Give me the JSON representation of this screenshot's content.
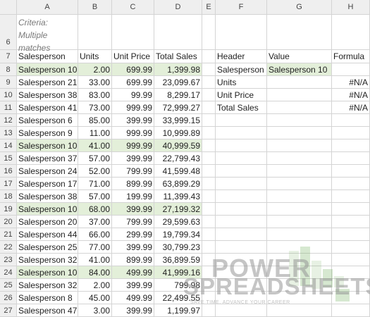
{
  "columns": [
    "A",
    "B",
    "C",
    "D",
    "E",
    "F",
    "G",
    "H"
  ],
  "notes": [
    "Criteria:",
    "Multiple",
    "matches"
  ],
  "header_row": {
    "num": "7",
    "a": "Salesperson",
    "b": "Units",
    "c": "Unit Price",
    "d": "Total Sales",
    "f": "Header",
    "g": "Value",
    "h": "Formula"
  },
  "rows": [
    {
      "num": "8",
      "a": "Salesperson 10",
      "b": "2.00",
      "c": "699.99",
      "d": "1,399.98",
      "f": "Salesperson",
      "g": "Salesperson 10",
      "h": "",
      "hl": true
    },
    {
      "num": "9",
      "a": "Salesperson 21",
      "b": "33.00",
      "c": "699.99",
      "d": "23,099.67",
      "f": "Units",
      "g": "",
      "h": "#N/A",
      "hl": false
    },
    {
      "num": "10",
      "a": "Salesperson 38",
      "b": "83.00",
      "c": "99.99",
      "d": "8,299.17",
      "f": "Unit Price",
      "g": "",
      "h": "#N/A",
      "hl": false
    },
    {
      "num": "11",
      "a": "Salesperson 41",
      "b": "73.00",
      "c": "999.99",
      "d": "72,999.27",
      "f": "Total Sales",
      "g": "",
      "h": "#N/A",
      "hl": false
    },
    {
      "num": "12",
      "a": "Salesperson 6",
      "b": "85.00",
      "c": "399.99",
      "d": "33,999.15",
      "f": "",
      "g": "",
      "h": "",
      "hl": false
    },
    {
      "num": "13",
      "a": "Salesperson 9",
      "b": "11.00",
      "c": "999.99",
      "d": "10,999.89",
      "f": "",
      "g": "",
      "h": "",
      "hl": false
    },
    {
      "num": "14",
      "a": "Salesperson 10",
      "b": "41.00",
      "c": "999.99",
      "d": "40,999.59",
      "f": "",
      "g": "",
      "h": "",
      "hl": true
    },
    {
      "num": "15",
      "a": "Salesperson 37",
      "b": "57.00",
      "c": "399.99",
      "d": "22,799.43",
      "f": "",
      "g": "",
      "h": "",
      "hl": false
    },
    {
      "num": "16",
      "a": "Salesperson 24",
      "b": "52.00",
      "c": "799.99",
      "d": "41,599.48",
      "f": "",
      "g": "",
      "h": "",
      "hl": false
    },
    {
      "num": "17",
      "a": "Salesperson 17",
      "b": "71.00",
      "c": "899.99",
      "d": "63,899.29",
      "f": "",
      "g": "",
      "h": "",
      "hl": false
    },
    {
      "num": "18",
      "a": "Salesperson 38",
      "b": "57.00",
      "c": "199.99",
      "d": "11,399.43",
      "f": "",
      "g": "",
      "h": "",
      "hl": false
    },
    {
      "num": "19",
      "a": "Salesperson 10",
      "b": "68.00",
      "c": "399.99",
      "d": "27,199.32",
      "f": "",
      "g": "",
      "h": "",
      "hl": true
    },
    {
      "num": "20",
      "a": "Salesperson 20",
      "b": "37.00",
      "c": "799.99",
      "d": "29,599.63",
      "f": "",
      "g": "",
      "h": "",
      "hl": false
    },
    {
      "num": "21",
      "a": "Salesperson 44",
      "b": "66.00",
      "c": "299.99",
      "d": "19,799.34",
      "f": "",
      "g": "",
      "h": "",
      "hl": false
    },
    {
      "num": "22",
      "a": "Salesperson 25",
      "b": "77.00",
      "c": "399.99",
      "d": "30,799.23",
      "f": "",
      "g": "",
      "h": "",
      "hl": false
    },
    {
      "num": "23",
      "a": "Salesperson 32",
      "b": "41.00",
      "c": "899.99",
      "d": "36,899.59",
      "f": "",
      "g": "",
      "h": "",
      "hl": false
    },
    {
      "num": "24",
      "a": "Salesperson 10",
      "b": "84.00",
      "c": "499.99",
      "d": "41,999.16",
      "f": "",
      "g": "",
      "h": "",
      "hl": true
    },
    {
      "num": "25",
      "a": "Salesperson 32",
      "b": "2.00",
      "c": "399.99",
      "d": "799.98",
      "f": "",
      "g": "",
      "h": "",
      "hl": false
    },
    {
      "num": "26",
      "a": "Salesperson 8",
      "b": "45.00",
      "c": "499.99",
      "d": "22,499.55",
      "f": "",
      "g": "",
      "h": "",
      "hl": false
    },
    {
      "num": "27",
      "a": "Salesperson 47",
      "b": "3.00",
      "c": "399.99",
      "d": "1,199.97",
      "f": "",
      "g": "",
      "h": "",
      "hl": false
    }
  ],
  "watermark": {
    "line1": "POWER",
    "line2": "SPREADSHEETS",
    "tagline": "SAVE TIME. ADVANCE YOUR CAREER"
  },
  "colors": {
    "highlight": "#e3efd9",
    "header_bg": "#efefef",
    "grid": "#d4d4d4",
    "note": "#7a7a7a"
  }
}
